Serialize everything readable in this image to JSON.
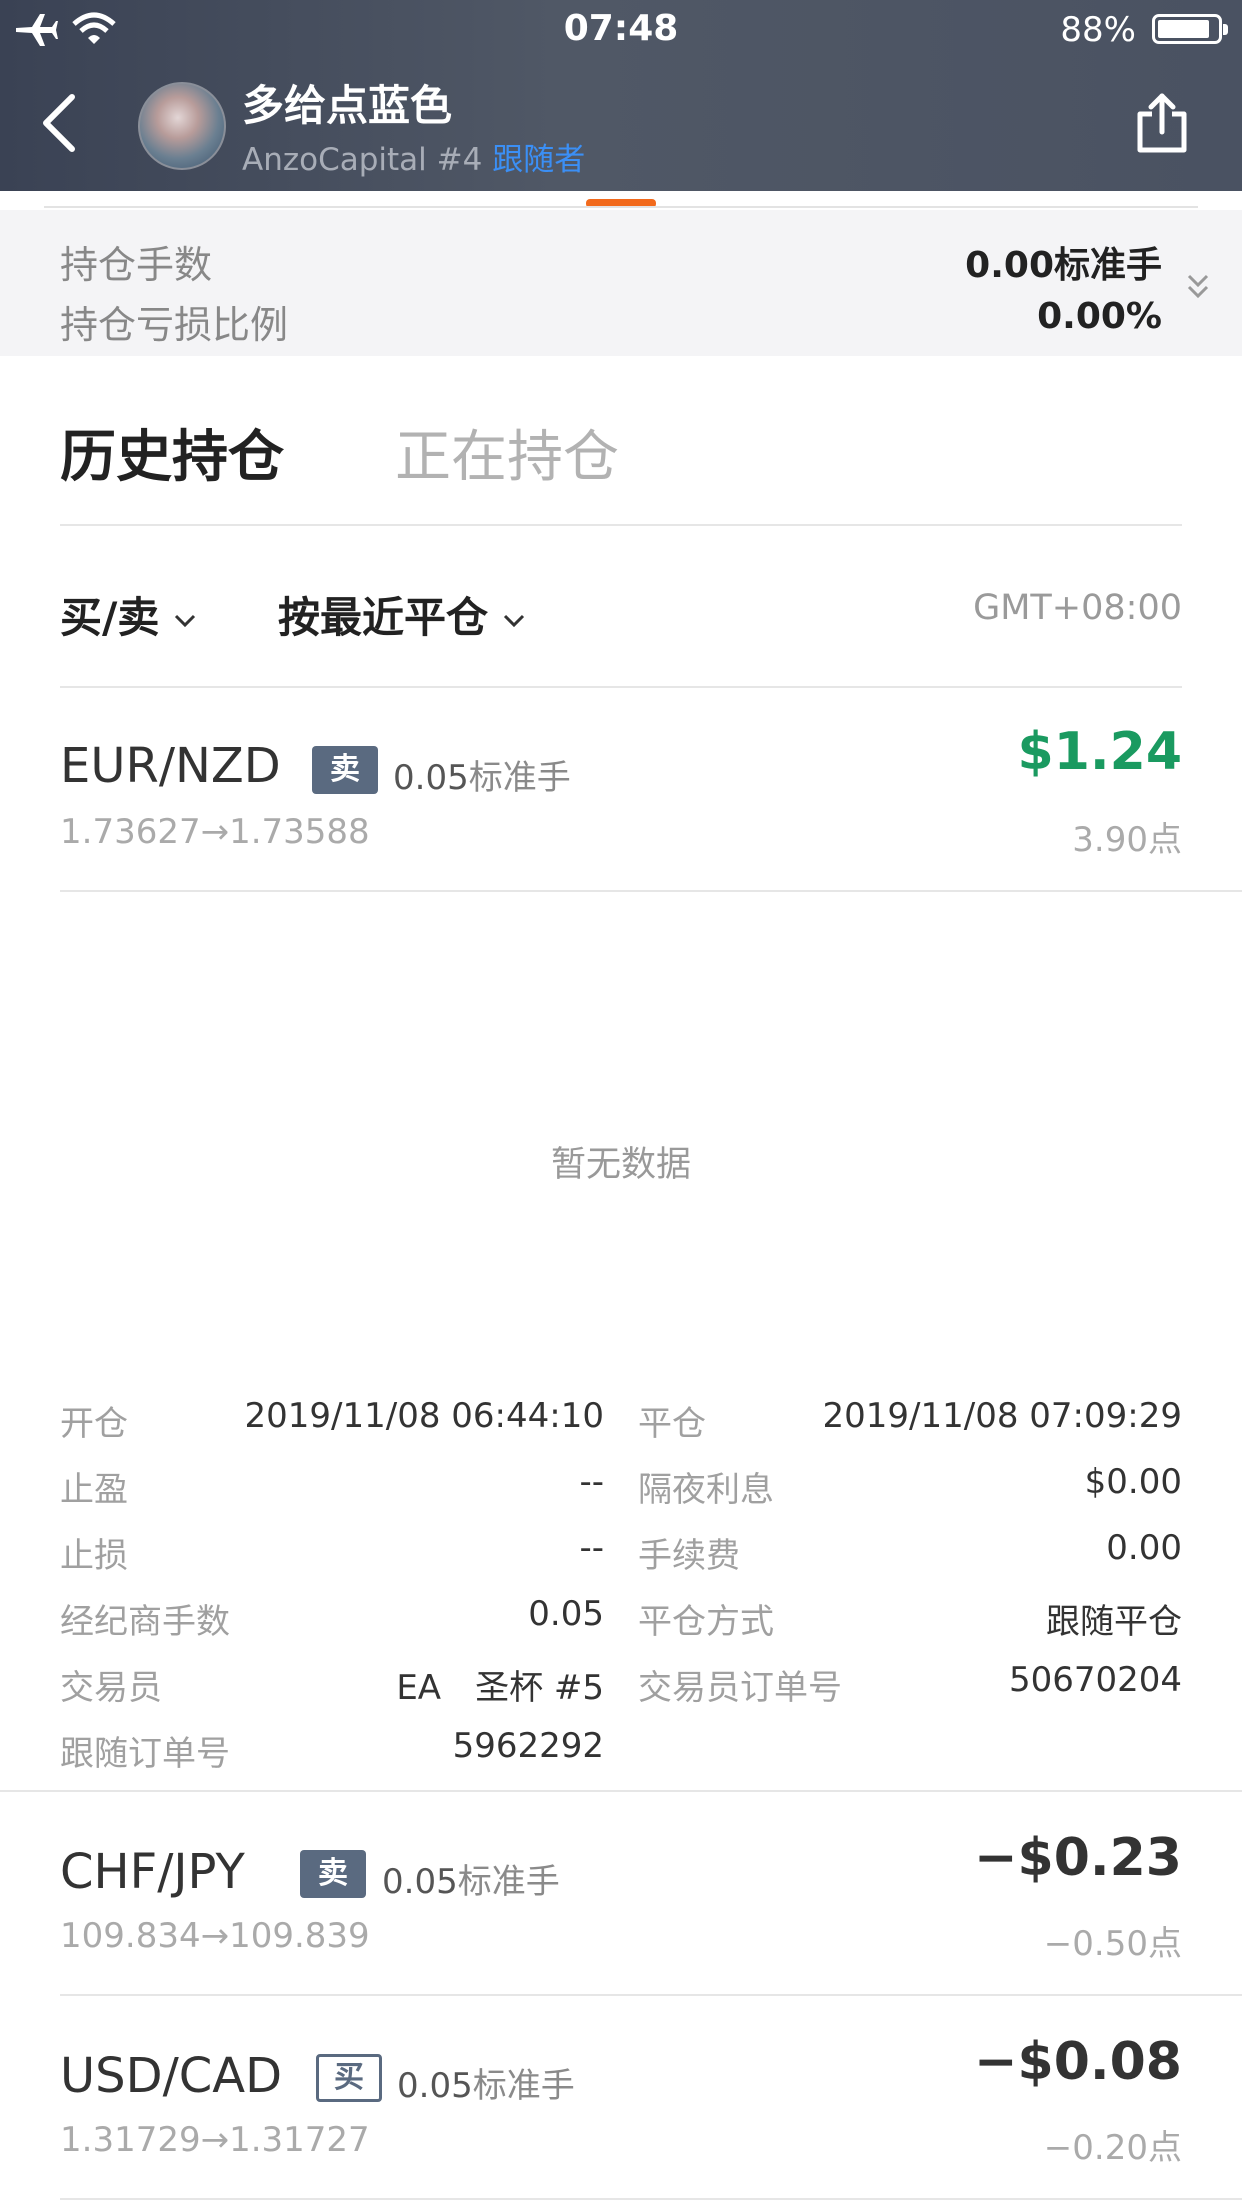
{
  "status": {
    "time": "07:48",
    "battery_pct": "88%",
    "battery_level": 0.88
  },
  "header": {
    "nickname": "多给点蓝色",
    "broker": "AnzoCapital #4",
    "role": "跟随者"
  },
  "summary": {
    "lots_label": "持仓手数",
    "lots_value": "0.00标准手",
    "pl_label": "持仓亏损比例",
    "pl_value": "0.00%"
  },
  "tabs": {
    "history": "历史持仓",
    "open": "正在持仓"
  },
  "filters": {
    "side": "买/卖",
    "sort": "按最近平仓",
    "timezone": "GMT+08:00"
  },
  "trades": [
    {
      "pair": "EUR/NZD",
      "side": "卖",
      "lots": "0.05",
      "unit": "标准手",
      "prices": "1.73627→1.73588",
      "profit": "$1.24",
      "points": "3.90点"
    },
    {
      "pair": "CHF/JPY",
      "side": "卖",
      "lots": "0.05",
      "unit": "标准手",
      "prices": "109.834→109.839",
      "profit": "−$0.23",
      "points": "−0.50点"
    },
    {
      "pair": "USD/CAD",
      "side": "买",
      "lots": "0.05",
      "unit": "标准手",
      "prices": "1.31729→1.31727",
      "profit": "−$0.08",
      "points": "−0.20点"
    }
  ],
  "empty_text": "暂无数据",
  "details": {
    "open_label": "开仓",
    "open_value": "2019/11/08 06:44:10",
    "close_label": "平仓",
    "close_value": "2019/11/08 07:09:29",
    "tp_label": "止盈",
    "tp_value": "--",
    "swap_label": "隔夜利息",
    "swap_value": "$0.00",
    "sl_label": "止损",
    "sl_value": "--",
    "fee_label": "手续费",
    "fee_value": "0.00",
    "broker_lots_label": "经纪商手数",
    "broker_lots_value": "0.05",
    "close_method_label": "平仓方式",
    "close_method_value": "跟随平仓",
    "trader_label": "交易员",
    "trader_value": "EA　圣杯 #5",
    "trader_order_label": "交易员订单号",
    "trader_order_value": "50670204",
    "follow_order_label": "跟随订单号",
    "follow_order_value": "5962292"
  }
}
